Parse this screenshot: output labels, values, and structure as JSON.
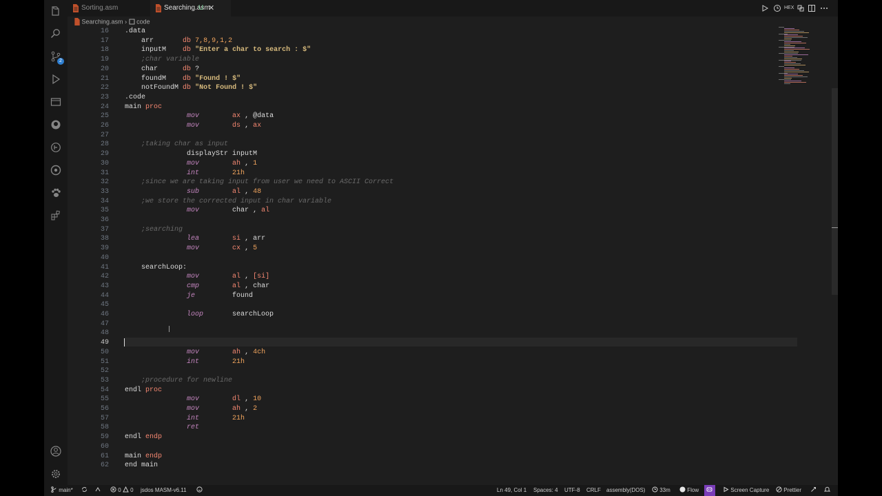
{
  "tabs": [
    {
      "label": "Sorting.asm"
    },
    {
      "label": "Searching.asm",
      "modified": "U"
    }
  ],
  "breadcrumb": {
    "file": "Searching.asm",
    "sep": "›",
    "symbol": "code"
  },
  "editor": {
    "cursor_line": 49,
    "lines": [
      {
        "n": "16",
        "t": ".data"
      },
      {
        "n": "17",
        "t": "    arr       db 7,8,9,1,2"
      },
      {
        "n": "18",
        "t": "    inputM    db \"Enter a char to search : $\""
      },
      {
        "n": "19",
        "t": "    ;char variable"
      },
      {
        "n": "20",
        "t": "    char      db ?"
      },
      {
        "n": "21",
        "t": "    foundM    db \"Found ! $\""
      },
      {
        "n": "22",
        "t": "    notFoundM db \"Not Found ! $\""
      },
      {
        "n": "23",
        "t": ".code"
      },
      {
        "n": "24",
        "t": "main proc"
      },
      {
        "n": "25",
        "t": "               mov        ax , @data"
      },
      {
        "n": "26",
        "t": "               mov        ds , ax"
      },
      {
        "n": "27",
        "t": ""
      },
      {
        "n": "28",
        "t": "    ;taking char as input"
      },
      {
        "n": "29",
        "t": "               displayStr inputM"
      },
      {
        "n": "30",
        "t": "               mov        ah , 1"
      },
      {
        "n": "31",
        "t": "               int        21h"
      },
      {
        "n": "32",
        "t": "    ;since we are taking input from user we need to ASCII Correct"
      },
      {
        "n": "33",
        "t": "               sub        al , 48"
      },
      {
        "n": "34",
        "t": "    ;we store the corrected input in char variable"
      },
      {
        "n": "35",
        "t": "               mov        char , al"
      },
      {
        "n": "36",
        "t": ""
      },
      {
        "n": "37",
        "t": "    ;searching"
      },
      {
        "n": "38",
        "t": "               lea        si , arr"
      },
      {
        "n": "39",
        "t": "               mov        cx , 5"
      },
      {
        "n": "40",
        "t": ""
      },
      {
        "n": "41",
        "t": "    searchLoop:"
      },
      {
        "n": "42",
        "t": "               mov        al , [si]"
      },
      {
        "n": "43",
        "t": "               cmp        al , char"
      },
      {
        "n": "44",
        "t": "               je         found"
      },
      {
        "n": "45",
        "t": ""
      },
      {
        "n": "46",
        "t": "               loop       searchLoop"
      },
      {
        "n": "47",
        "t": ""
      },
      {
        "n": "48",
        "t": ""
      },
      {
        "n": "49",
        "t": ""
      },
      {
        "n": "50",
        "t": "               mov        ah , 4ch"
      },
      {
        "n": "51",
        "t": "               int        21h"
      },
      {
        "n": "52",
        "t": ""
      },
      {
        "n": "53",
        "t": "    ;procedure for newline"
      },
      {
        "n": "54",
        "t": "endl proc"
      },
      {
        "n": "55",
        "t": "               mov        dl , 10"
      },
      {
        "n": "56",
        "t": "               mov        ah , 2"
      },
      {
        "n": "57",
        "t": "               int        21h"
      },
      {
        "n": "58",
        "t": "               ret"
      },
      {
        "n": "59",
        "t": "endl endp"
      },
      {
        "n": "60",
        "t": ""
      },
      {
        "n": "61",
        "t": "main endp"
      },
      {
        "n": "62",
        "t": "end main"
      }
    ]
  },
  "activity_bar": {
    "icons": [
      "explorer-icon",
      "search-icon",
      "source-control-icon",
      "run-debug-icon",
      "remote-explorer-icon",
      "github-icon",
      "timeline-icon",
      "gitlens-icon",
      "extensions-pets-icon",
      "extensions-icon",
      "account-icon",
      "settings-gear-icon"
    ],
    "scm_badge": "2"
  },
  "status": {
    "branch": "main*",
    "problems_errors": "0",
    "problems_warnings": "0",
    "env": "jsdos MASM-v6.11",
    "position": "Ln 49, Col 1",
    "spaces": "Spaces: 4",
    "encoding": "UTF-8",
    "eol": "CRLF",
    "language": "assembly(DOS)",
    "time": "33m",
    "flow": "Flow",
    "capture": "Screen Capture",
    "prettier": "Prettier"
  },
  "colors": {
    "accent": "#2f7fd1",
    "keyword": "#c586c0",
    "register": "#f48771",
    "number": "#f0a45d",
    "string": "#d7ba7d",
    "comment": "#6a6a6a"
  }
}
